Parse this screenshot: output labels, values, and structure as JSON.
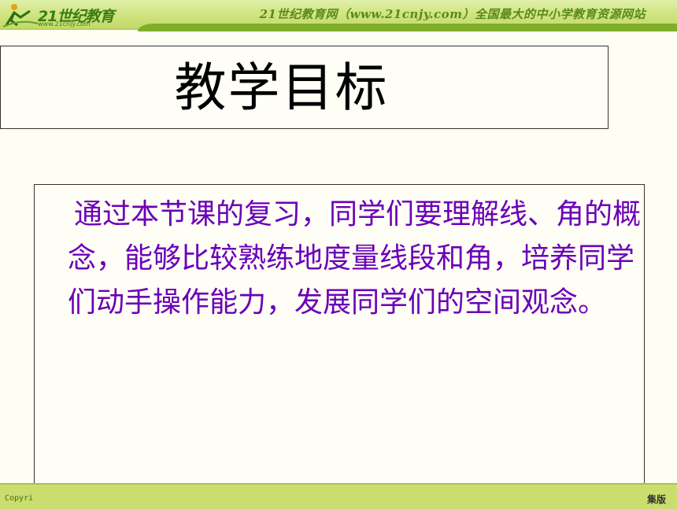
{
  "header": {
    "logo_text": "21世纪教育",
    "logo_sub": "www.21cnjy.com",
    "banner": "21世纪教育网（www.21cnjy.com）全国最大的中小学教育资源网站"
  },
  "slide": {
    "title": "教学目标",
    "body": "通过本节课的复习，同学们要理解线、角的概念，能够比较熟练地度量线段和角，培养同学们动手操作能力，发展同学们的空间观念。"
  },
  "footer": {
    "left_text": "Copyri",
    "right_text": "集版"
  },
  "colors": {
    "header_green": "#cde27a",
    "accent_green": "#7fae2a",
    "body_text": "#6a00b8",
    "background": "#fffef4"
  }
}
